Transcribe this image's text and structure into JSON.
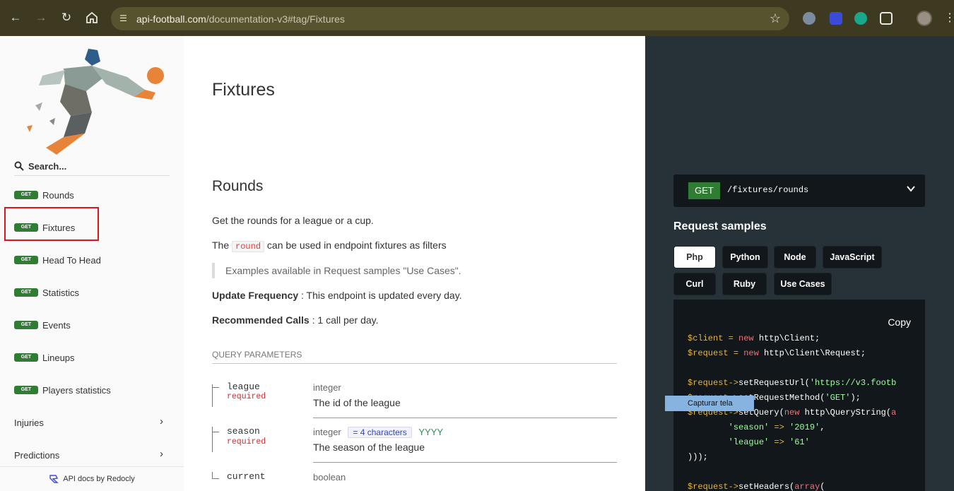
{
  "browser": {
    "url_host": "api-football.com",
    "url_path": "/documentation-v3#tag/Fixtures",
    "icons": [
      "back-icon",
      "forward-icon",
      "reload-icon",
      "home-icon",
      "site-info-icon",
      "bookmark-star-icon",
      "extension-icon",
      "more-menu-icon"
    ]
  },
  "sidebar": {
    "search_placeholder": "Search...",
    "items": [
      {
        "badge": "GET",
        "label": "Rounds"
      },
      {
        "badge": "GET",
        "label": "Fixtures"
      },
      {
        "badge": "GET",
        "label": "Head To Head"
      },
      {
        "badge": "GET",
        "label": "Statistics"
      },
      {
        "badge": "GET",
        "label": "Events"
      },
      {
        "badge": "GET",
        "label": "Lineups"
      },
      {
        "badge": "GET",
        "label": "Players statistics"
      }
    ],
    "groups": [
      {
        "label": "Injuries"
      },
      {
        "label": "Predictions"
      }
    ],
    "footer": "API docs by Redocly"
  },
  "content": {
    "title": "Fixtures",
    "section_title": "Rounds",
    "description": "Get the rounds for a league or a cup.",
    "round_text_before": "The",
    "round_code": "round",
    "round_text_after": "can be used in endpoint fixtures as filters",
    "blockquote": "Examples available in Request samples \"Use Cases\".",
    "update_label": "Update Frequency",
    "update_text": " : This endpoint is updated every day.",
    "calls_label": "Recommended Calls",
    "calls_text": " : 1 call per day.",
    "query_params_header": "QUERY PARAMETERS",
    "params": [
      {
        "name": "league",
        "required": "required",
        "type": "integer",
        "desc": "The id of the league"
      },
      {
        "name": "season",
        "required": "required",
        "type": "integer",
        "constraint": "= 4 characters",
        "example": "YYYY",
        "desc": "The season of the league"
      },
      {
        "name": "current",
        "type": "boolean"
      }
    ]
  },
  "right_panel": {
    "method": "GET",
    "path": "/fixtures/rounds",
    "request_samples_title": "Request samples",
    "tabs": [
      "Php",
      "Python",
      "Node",
      "JavaScript",
      "Curl",
      "Ruby",
      "Use Cases"
    ],
    "active_tab": "Php",
    "copy_label": "Copy",
    "tooltip": "Capturar tela"
  },
  "colors": {
    "chrome_bg": "#3d3a21",
    "get_badge": "#2e7d32",
    "dark_panel": "#263238",
    "code_bg": "#11171a",
    "highlight_box": "#e0161b"
  }
}
